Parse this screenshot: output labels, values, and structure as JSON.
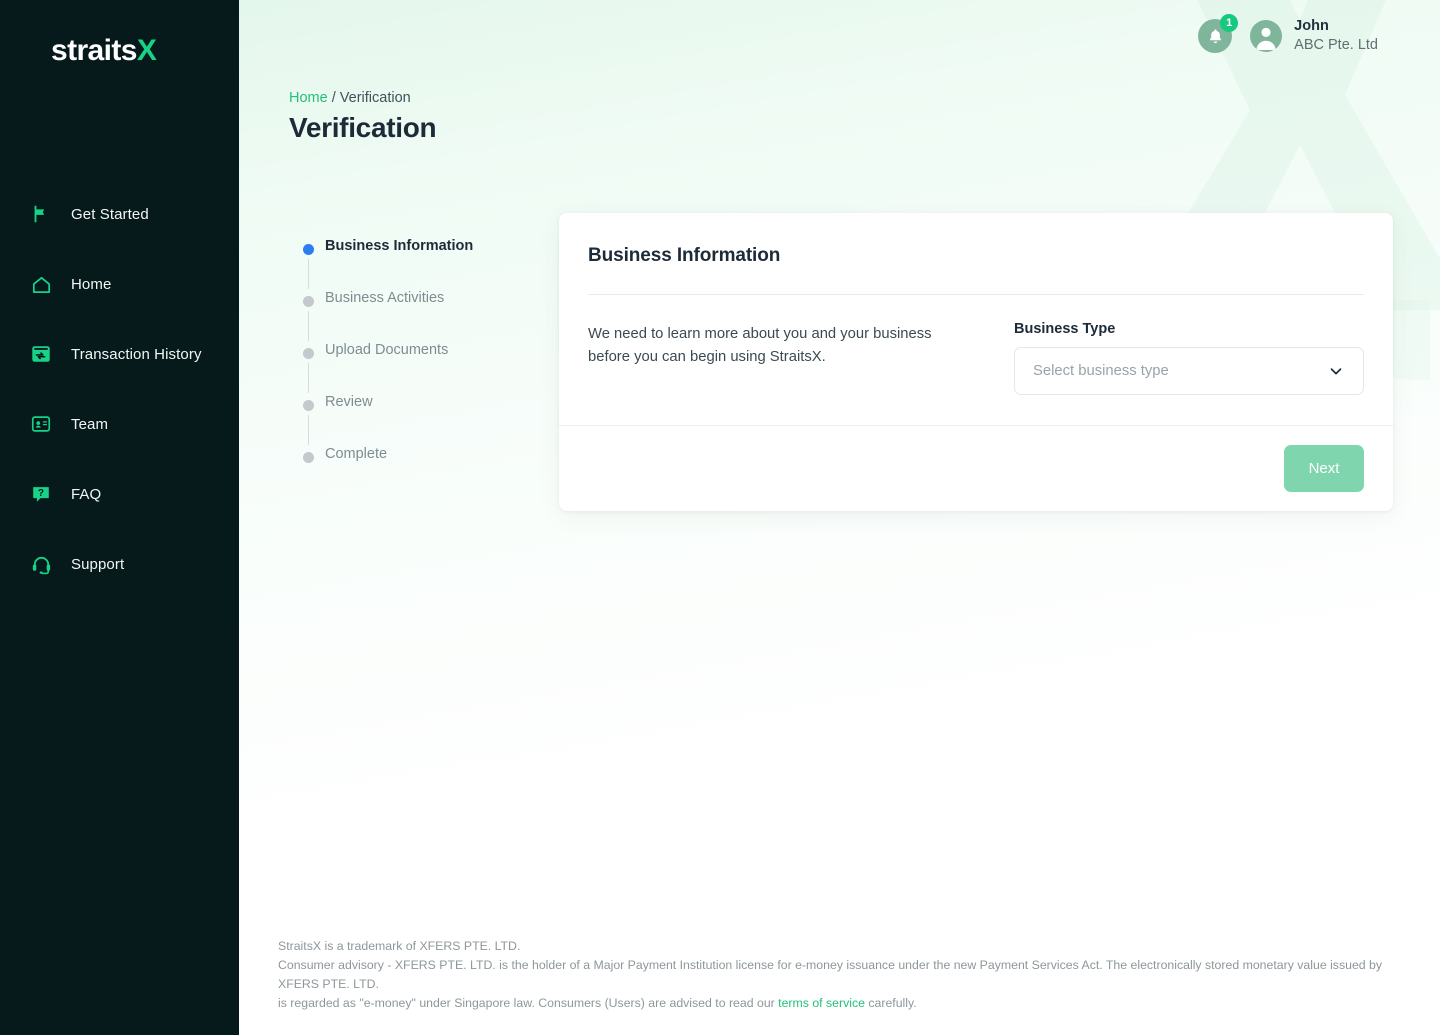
{
  "brand": {
    "logo_text": "straits",
    "logo_accent": "X",
    "accent_color": "#17d287",
    "sidebar_bg": "#06191b"
  },
  "sidebar": {
    "items": [
      {
        "label": "Get Started",
        "icon": "flag-icon"
      },
      {
        "label": "Home",
        "icon": "home-icon"
      },
      {
        "label": "Transaction History",
        "icon": "transaction-history-icon"
      },
      {
        "label": "Team",
        "icon": "id-card-icon"
      },
      {
        "label": "FAQ",
        "icon": "question-bubble-icon"
      },
      {
        "label": "Support",
        "icon": "headset-icon"
      }
    ]
  },
  "topbar": {
    "notifications": {
      "icon": "bell-icon",
      "count": "1",
      "badge_color": "#17c97f"
    },
    "user": {
      "avatar_icon": "user-avatar-icon",
      "name": "John",
      "organization": "ABC Pte. Ltd"
    }
  },
  "page": {
    "breadcrumb": {
      "home": "Home",
      "separator": "/",
      "current": "Verification"
    },
    "title": "Verification"
  },
  "steps": [
    {
      "label": "Business Information",
      "state": "active"
    },
    {
      "label": "Business Activities",
      "state": "pending"
    },
    {
      "label": "Upload Documents",
      "state": "pending"
    },
    {
      "label": "Review",
      "state": "pending"
    },
    {
      "label": "Complete",
      "state": "pending"
    }
  ],
  "card": {
    "title": "Business Information",
    "lead": "We need to learn more about you and your business before you can begin using StraitsX.",
    "field": {
      "label": "Business Type",
      "placeholder": "Select business type",
      "value": "Select business type",
      "chevron_icon": "chevron-down-icon"
    },
    "next_label": "Next",
    "next_color": "#7fd5ae"
  },
  "footer": {
    "line1": "StraitsX is a trademark of XFERS PTE. LTD.",
    "line2a": "Consumer advisory - XFERS PTE. LTD. is the holder of a Major Payment Institution license for e-money issuance under the new Payment Services Act. The electronically stored monetary value issued by XFERS PTE. LTD.",
    "line2b": "is regarded as \"e-money\" under Singapore law. Consumers (Users) are advised to read our ",
    "tos_link": "terms of service",
    "line2c": " carefully."
  }
}
